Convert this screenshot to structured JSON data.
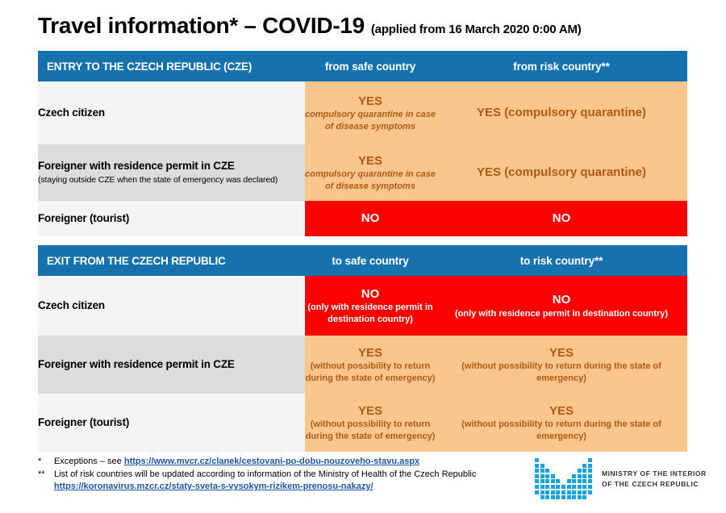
{
  "title": {
    "main": "Travel information* – COVID-19",
    "applied": "(applied from 16 March 2020 0:00 AM)"
  },
  "entry_table": {
    "header": {
      "label": "ENTRY TO THE CZECH REPUBLIC (CZE)",
      "safe": "from safe country",
      "risk": "from risk country**"
    },
    "rows": [
      {
        "label": "Czech citizen",
        "sublabel": "",
        "safe": {
          "verdict": "YES",
          "note": "compulsory quarantine in case of disease symptoms",
          "style": "orange"
        },
        "risk": {
          "verdict": "YES (compulsory quarantine)",
          "note": "",
          "style": "orange"
        }
      },
      {
        "label": "Foreigner with residence permit in CZE",
        "sublabel": "(staying outside CZE when the state of emergency was declared)",
        "safe": {
          "verdict": "YES",
          "note": "compulsory quarantine in case of disease symptoms",
          "style": "orange"
        },
        "risk": {
          "verdict": "YES (compulsory quarantine)",
          "note": "",
          "style": "orange"
        }
      },
      {
        "label": "Foreigner (tourist)",
        "sublabel": "",
        "safe": {
          "verdict": "NO",
          "note": "",
          "style": "red"
        },
        "risk": {
          "verdict": "NO",
          "note": "",
          "style": "red"
        }
      }
    ]
  },
  "exit_table": {
    "header": {
      "label": "EXIT FROM THE CZECH REPUBLIC",
      "safe": "to safe country",
      "risk": "to risk country**"
    },
    "rows": [
      {
        "label": "Czech citizen",
        "sublabel": "",
        "safe": {
          "verdict": "NO",
          "note": "(only with residence permit in destination country)",
          "style": "red"
        },
        "risk": {
          "verdict": "NO",
          "note": "(only with residence permit in destination country)",
          "style": "red"
        }
      },
      {
        "label": "Foreigner with residence permit in CZE",
        "sublabel": "",
        "safe": {
          "verdict": "YES",
          "note": "(without possibility to return during the state of emergency)",
          "style": "orange"
        },
        "risk": {
          "verdict": "YES",
          "note": "(without possibility to return during the state of emergency)",
          "style": "orange"
        }
      },
      {
        "label": "Foreigner (tourist)",
        "sublabel": "",
        "safe": {
          "verdict": "YES",
          "note": "(without possibility to return during the state of emergency)",
          "style": "orange"
        },
        "risk": {
          "verdict": "YES",
          "note": "(without possibility to return during the state of emergency)",
          "style": "orange"
        }
      }
    ]
  },
  "footnotes": {
    "one": {
      "mark": "*",
      "text": "Exceptions – see ",
      "link": "https://www.mvcr.cz/clanek/cestovani-po-dobu-nouzoveho-stavu.aspx"
    },
    "two": {
      "mark": "**",
      "text": "List of risk countries will be updated according to information of the Ministry of Health of the Czech Republic",
      "link": "https://koronavirus.mzcr.cz/staty-sveta-s-vysokym-rizikem-prenosu-nakazy/"
    }
  },
  "logo": {
    "line1": "MINISTRY OF THE INTERIOR",
    "line2": "OF THE CZECH REPUBLIC",
    "color": "#19A3DC"
  },
  "colors": {
    "header_blue": "#1572AD",
    "orange_fill": "#FAC68C",
    "orange_text": "#B05A14",
    "red_fill": "#FC0000",
    "row_light": "#F4F4F4",
    "row_dark": "#DCDCDC",
    "link_blue": "#1F56A5"
  }
}
